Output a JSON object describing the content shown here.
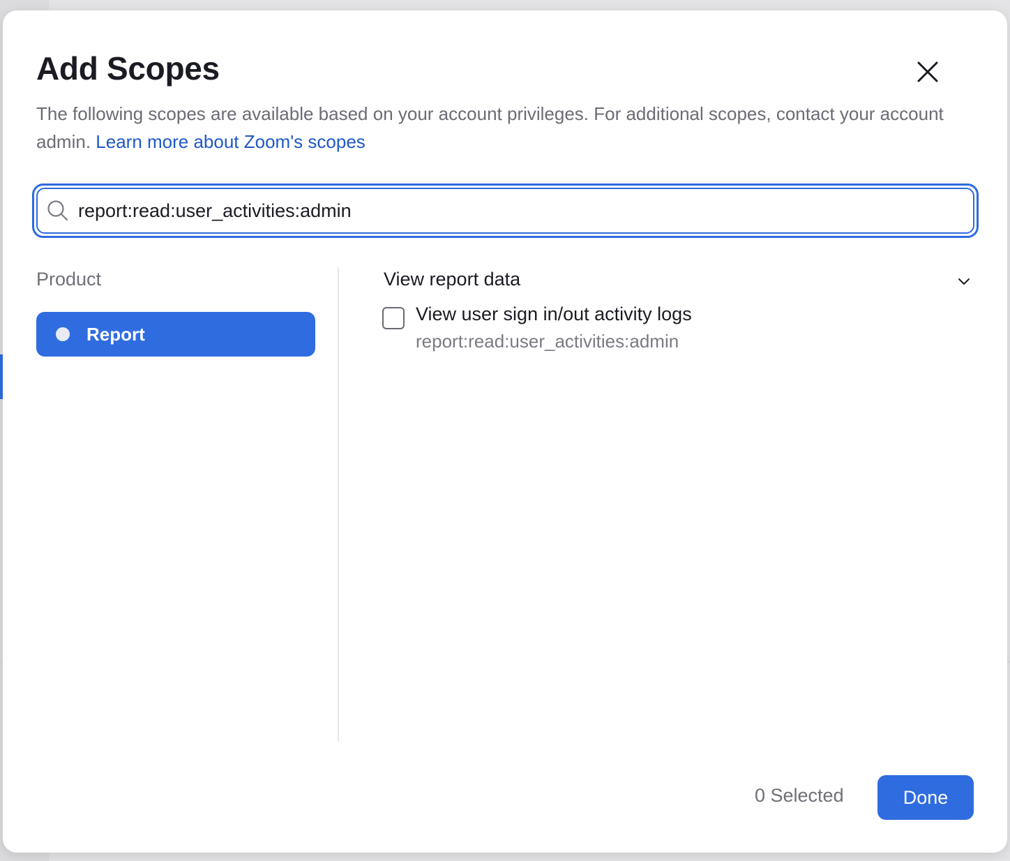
{
  "modal": {
    "title": "Add Scopes",
    "description_text": "The following scopes are available based on your account privileges. For additional scopes, contact your account admin.",
    "learn_more_link": "Learn more about Zoom's scopes",
    "close_icon": "close-icon"
  },
  "search": {
    "value": "report:read:user_activities:admin",
    "icon": "search-icon"
  },
  "products": {
    "label": "Product",
    "items": [
      {
        "label": "Report",
        "selected": true
      }
    ]
  },
  "scope_groups": [
    {
      "title": "View report data",
      "expanded": true,
      "scopes": [
        {
          "label": "View user sign in/out activity logs",
          "id": "report:read:user_activities:admin",
          "checked": false
        }
      ]
    }
  ],
  "footer": {
    "selected_count": "0 Selected",
    "done_label": "Done"
  },
  "colors": {
    "accent": "#2f6ce0",
    "link": "#1f58c7",
    "text_primary": "#1b1b24",
    "text_secondary": "#6f6f78"
  }
}
